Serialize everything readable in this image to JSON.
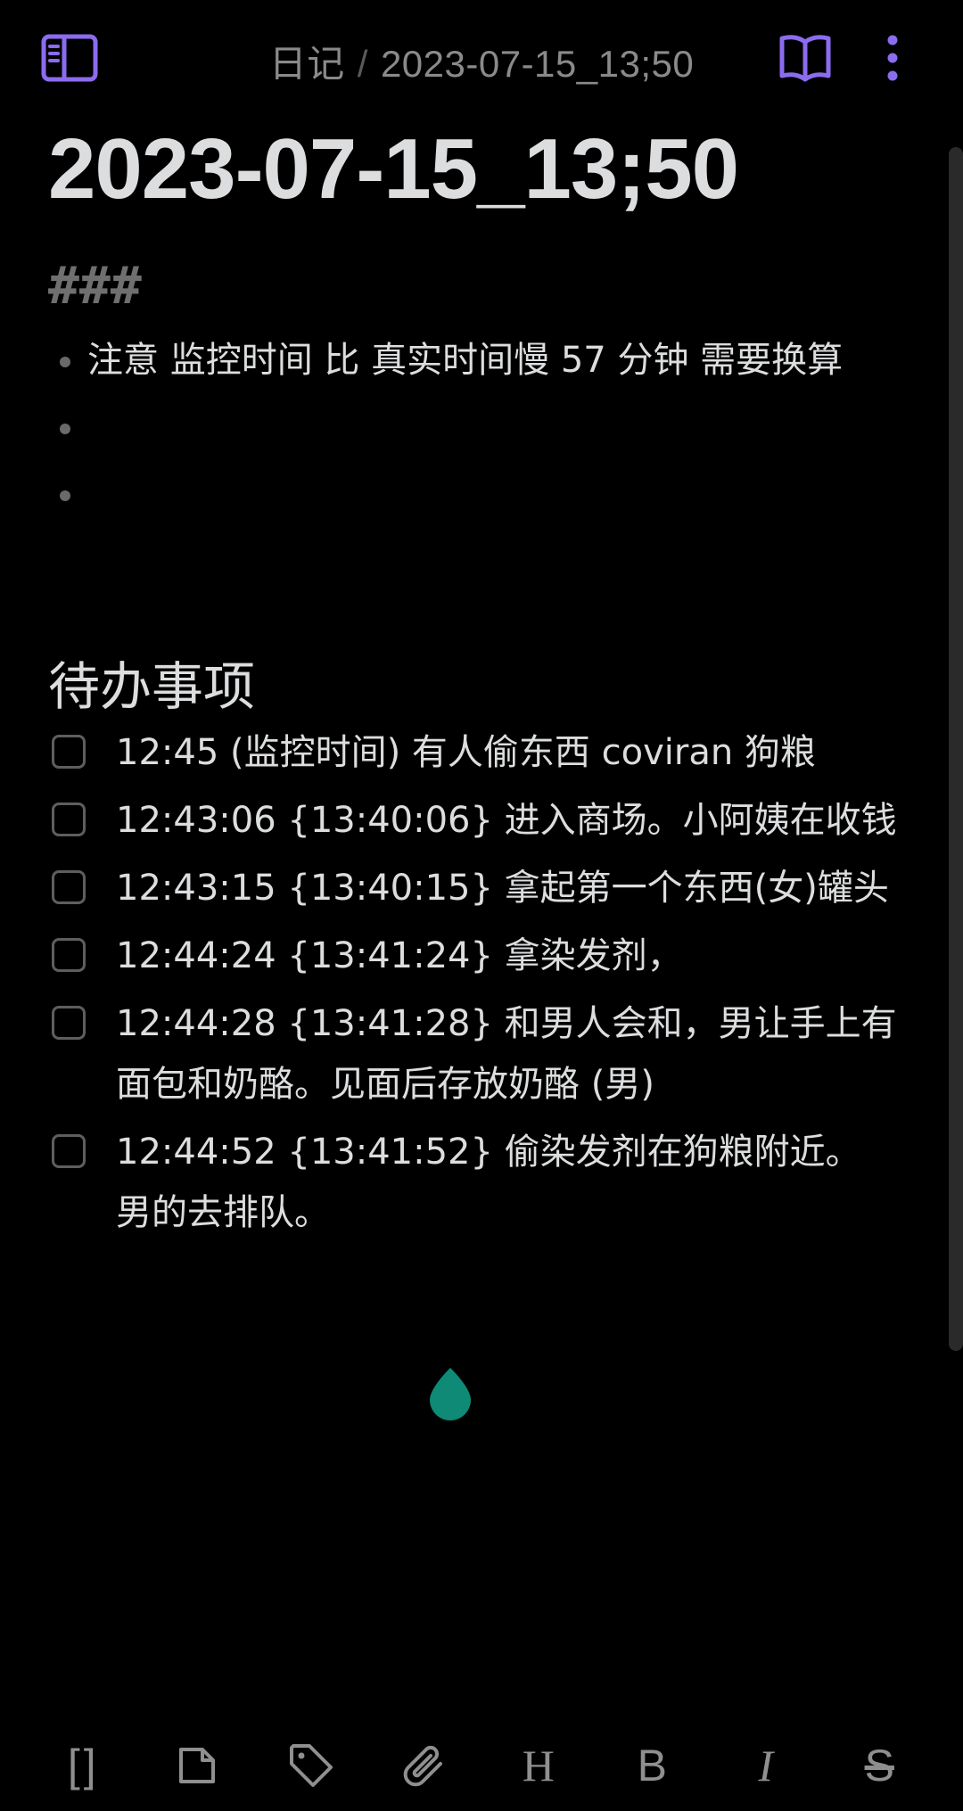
{
  "header": {
    "breadcrumb_folder": "日记",
    "breadcrumb_separator": "/",
    "breadcrumb_file": "2023-07-15_13;50",
    "accent_color": "#8b6cef"
  },
  "note": {
    "title": "2023-07-15_13;50",
    "heading_marker": "###",
    "bullets": [
      "注意  监控时间 比 真实时间慢 57 分钟 需要换算",
      "",
      ""
    ],
    "section_heading": "待办事项",
    "todos": [
      "12:45 (监控时间) 有人偷东西 coviran 狗粮",
      "12:43:06 {13:40:06} 进入商场。小阿姨在收钱",
      "12:43:15 {13:40:15}  拿起第一个东西(女)罐头",
      "12:44:24 {13:41:24}   拿染发剂，",
      "12:44:28  {13:41:28} 和男人会和，男让手上有面包和奶酪。见面后存放奶酪 (男)",
      "12:44:52 {13:41:52} 偷染发剂在狗粮附近。 男的去排队。"
    ]
  },
  "toolbar": {
    "items": [
      {
        "name": "wikilink-button",
        "icon": "brackets-icon",
        "glyph": "[]"
      },
      {
        "name": "new-file-button",
        "icon": "file-icon",
        "glyph": ""
      },
      {
        "name": "tag-button",
        "icon": "tag-icon",
        "glyph": ""
      },
      {
        "name": "attach-button",
        "icon": "paperclip-icon",
        "glyph": ""
      },
      {
        "name": "heading-button",
        "icon": "heading-icon",
        "glyph": "H"
      },
      {
        "name": "bold-button",
        "icon": "bold-icon",
        "glyph": "B"
      },
      {
        "name": "italic-button",
        "icon": "italic-icon",
        "glyph": "I"
      },
      {
        "name": "strikethrough-button",
        "icon": "strikethrough-icon",
        "glyph": "S"
      }
    ]
  },
  "cursor": {
    "color": "#0e8a77"
  }
}
